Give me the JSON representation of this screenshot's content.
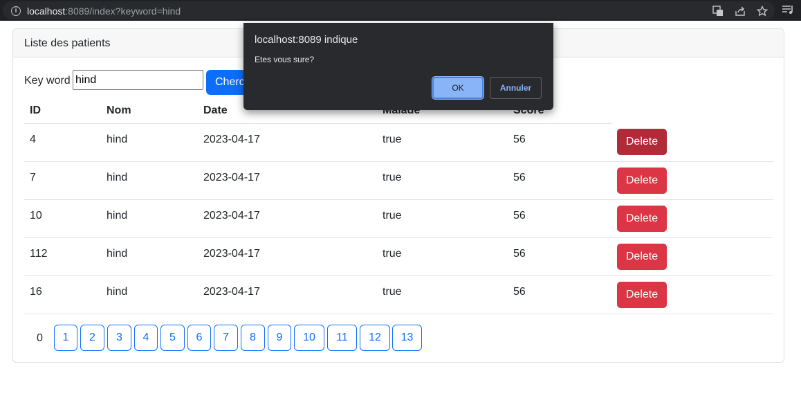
{
  "browser": {
    "url_host": "localhost",
    "url_rest": ":8089/index?keyword=hind"
  },
  "card": {
    "title": "Liste des patients"
  },
  "search": {
    "label": "Key word",
    "value": "hind",
    "button_label": "Chercher"
  },
  "table": {
    "headers": [
      "ID",
      "Nom",
      "Date",
      "Malade",
      "Score"
    ],
    "rows": [
      {
        "id": "4",
        "nom": "hind",
        "date": "2023-04-17",
        "malade": "true",
        "score": "56",
        "action": "Delete"
      },
      {
        "id": "7",
        "nom": "hind",
        "date": "2023-04-17",
        "malade": "true",
        "score": "56",
        "action": "Delete"
      },
      {
        "id": "10",
        "nom": "hind",
        "date": "2023-04-17",
        "malade": "true",
        "score": "56",
        "action": "Delete"
      },
      {
        "id": "112",
        "nom": "hind",
        "date": "2023-04-17",
        "malade": "true",
        "score": "56",
        "action": "Delete"
      },
      {
        "id": "16",
        "nom": "hind",
        "date": "2023-04-17",
        "malade": "true",
        "score": "56",
        "action": "Delete"
      }
    ]
  },
  "pagination": {
    "current": "0",
    "pages": [
      "1",
      "2",
      "3",
      "4",
      "5",
      "6",
      "7",
      "8",
      "9",
      "10",
      "11",
      "12",
      "13"
    ]
  },
  "dialog": {
    "title": "localhost:8089 indique",
    "message": "Etes vous sure?",
    "ok_label": "OK",
    "cancel_label": "Annuler"
  },
  "colors": {
    "primary": "#0d6efd",
    "danger": "#dc3545",
    "dialog_bg": "#292a2d",
    "dialog_ok": "#8ab4f8"
  },
  "icons": [
    "info-icon",
    "translate-icon",
    "share-icon",
    "star-icon",
    "reading-list-icon"
  ]
}
